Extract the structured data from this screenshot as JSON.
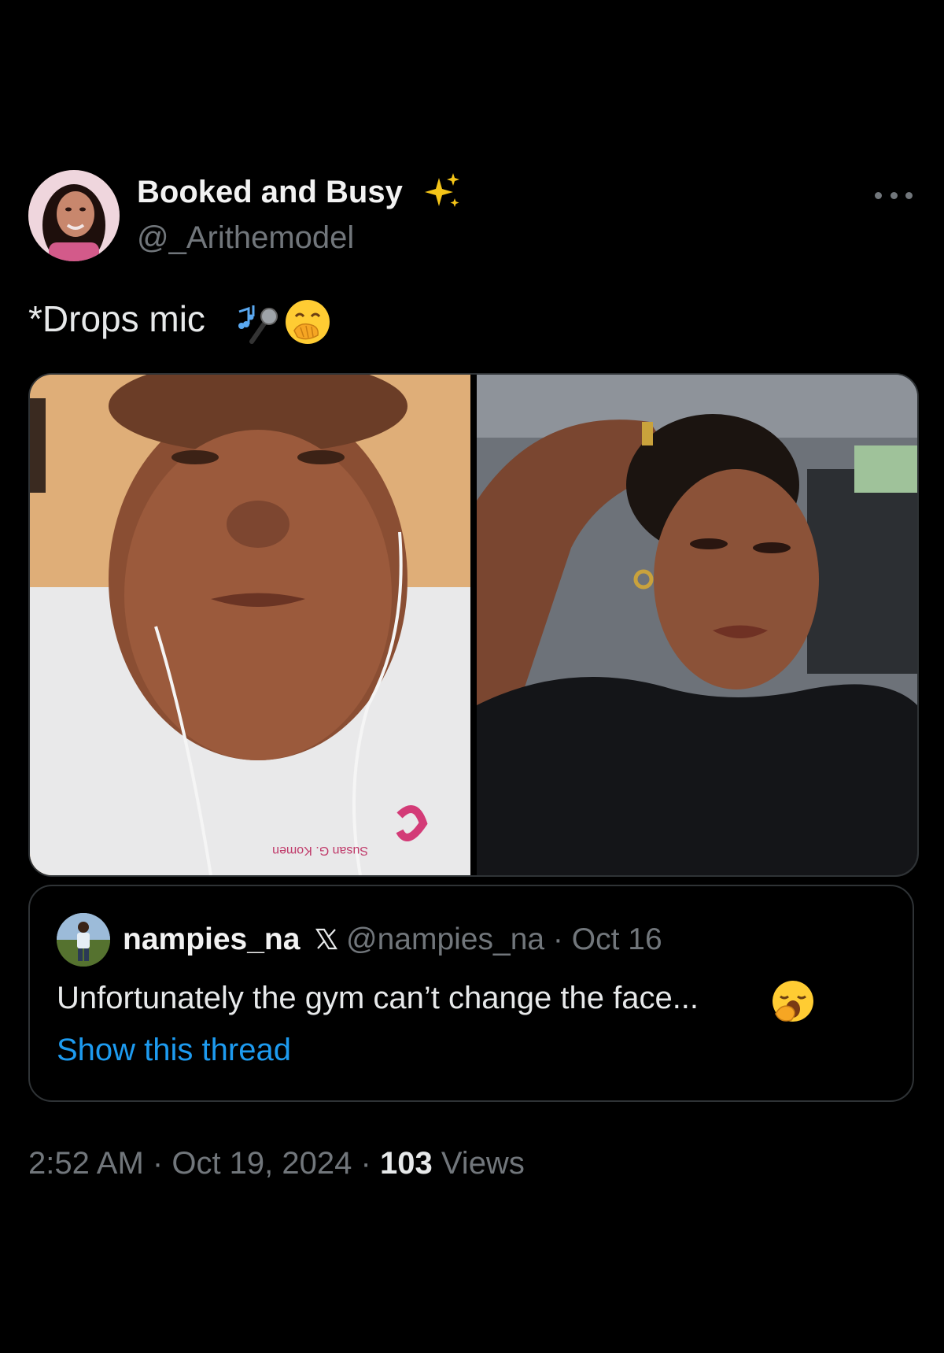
{
  "author": {
    "display_name": "Booked and Busy",
    "handle": "@_Arithemodel",
    "avatar_icon": "profile-photo",
    "badge_icon": "sparkles-emoji"
  },
  "tweet": {
    "text": "*Drops mic",
    "emojis": [
      "microphone-music-emoji",
      "hand-over-mouth-emoji"
    ]
  },
  "media": {
    "count": 2,
    "shirt_print": "Susan G. Komen"
  },
  "quoted_tweet": {
    "name": "nampies_na",
    "verified_icon": "x-logo-icon",
    "handle": "@nampies_na",
    "separator": "·",
    "date": "Oct 16",
    "text": "Unfortunately the gym can’t change the face...",
    "emoji": "yawning-face-emoji",
    "show_thread_label": "Show this thread"
  },
  "meta": {
    "time": "2:52 AM",
    "separator": "·",
    "date": "Oct 19, 2024",
    "views_count": "103",
    "views_label": "Views"
  },
  "colors": {
    "background": "#000000",
    "text_primary": "#e7e9ea",
    "text_secondary": "#71767b",
    "link": "#1d9bf0",
    "border": "#2f3336"
  }
}
